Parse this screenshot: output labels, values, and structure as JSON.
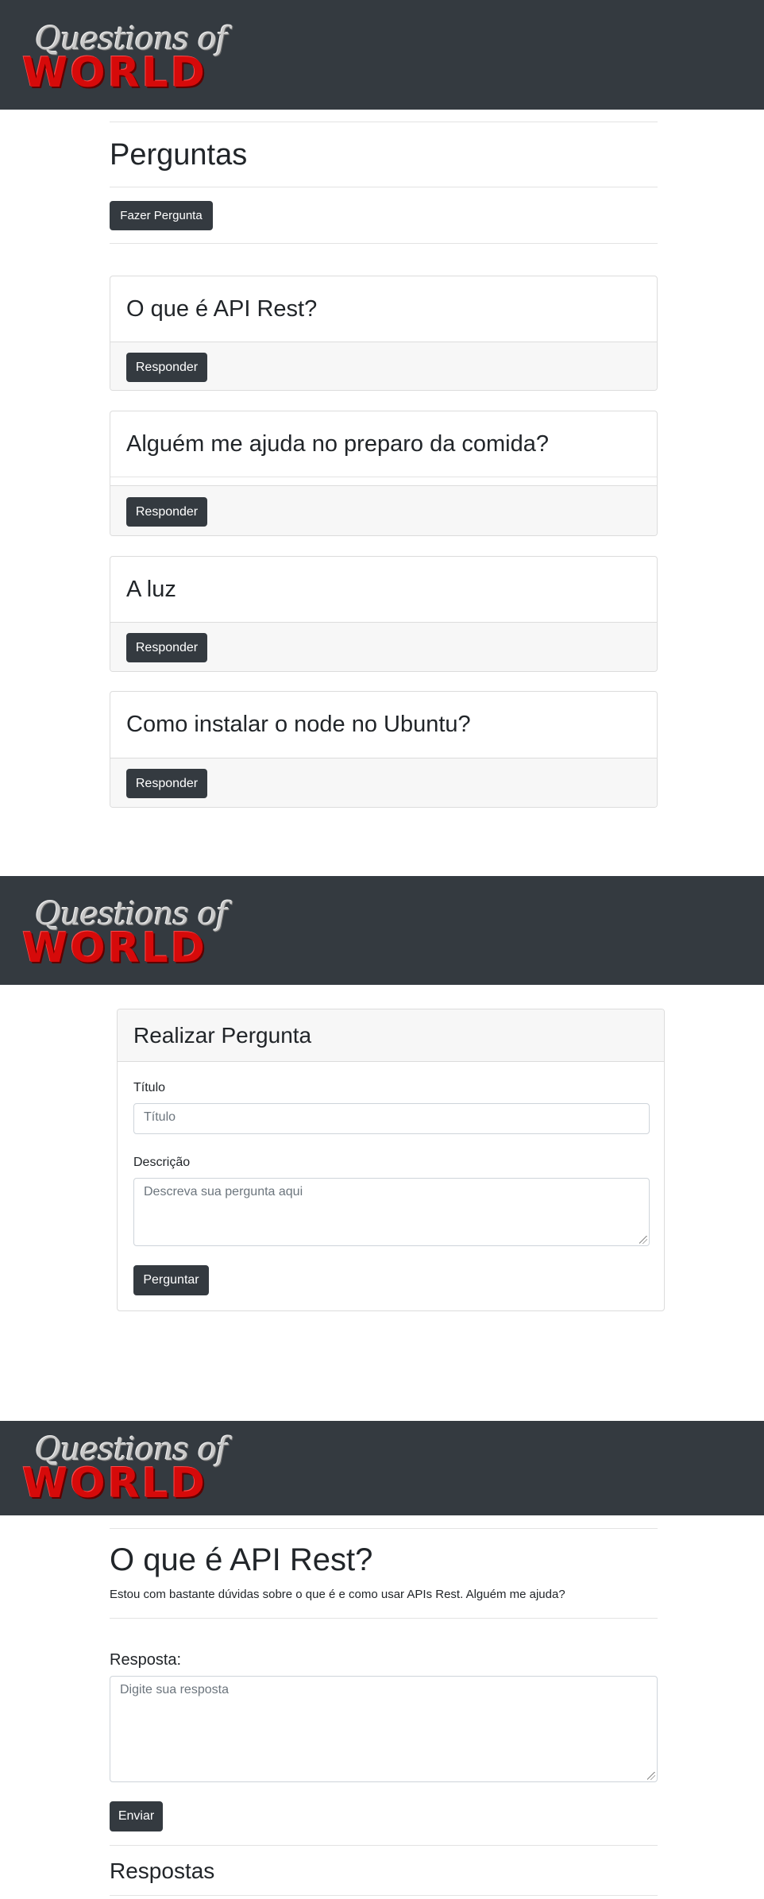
{
  "brand": {
    "line1": "Questions of",
    "line2": "WORLD"
  },
  "questions_page": {
    "title": "Perguntas",
    "ask_button": "Fazer Pergunta",
    "questions": [
      {
        "title": "O que é API Rest?",
        "button": "Responder"
      },
      {
        "title": "Alguém me ajuda no preparo da comida?",
        "button": "Responder"
      },
      {
        "title": "A luz",
        "button": "Responder"
      },
      {
        "title": "Como instalar o node no Ubuntu?",
        "button": "Responder"
      }
    ]
  },
  "ask_page": {
    "header": "Realizar Pergunta",
    "title_label": "Título",
    "title_placeholder": "Título",
    "description_label": "Descrição",
    "description_placeholder": "Descreva sua pergunta aqui",
    "submit": "Perguntar"
  },
  "detail_page": {
    "question_title": "O que é API Rest?",
    "question_body": "Estou com bastante dúvidas sobre o que é e como usar APIs Rest. Alguém me ajuda?",
    "answer_label": "Resposta:",
    "answer_placeholder": "Digite sua resposta",
    "send": "Enviar",
    "answers_heading": "Respostas"
  },
  "colors": {
    "navbar": "#343a40",
    "button": "#343a40",
    "logo_red": "#d60a0a"
  }
}
